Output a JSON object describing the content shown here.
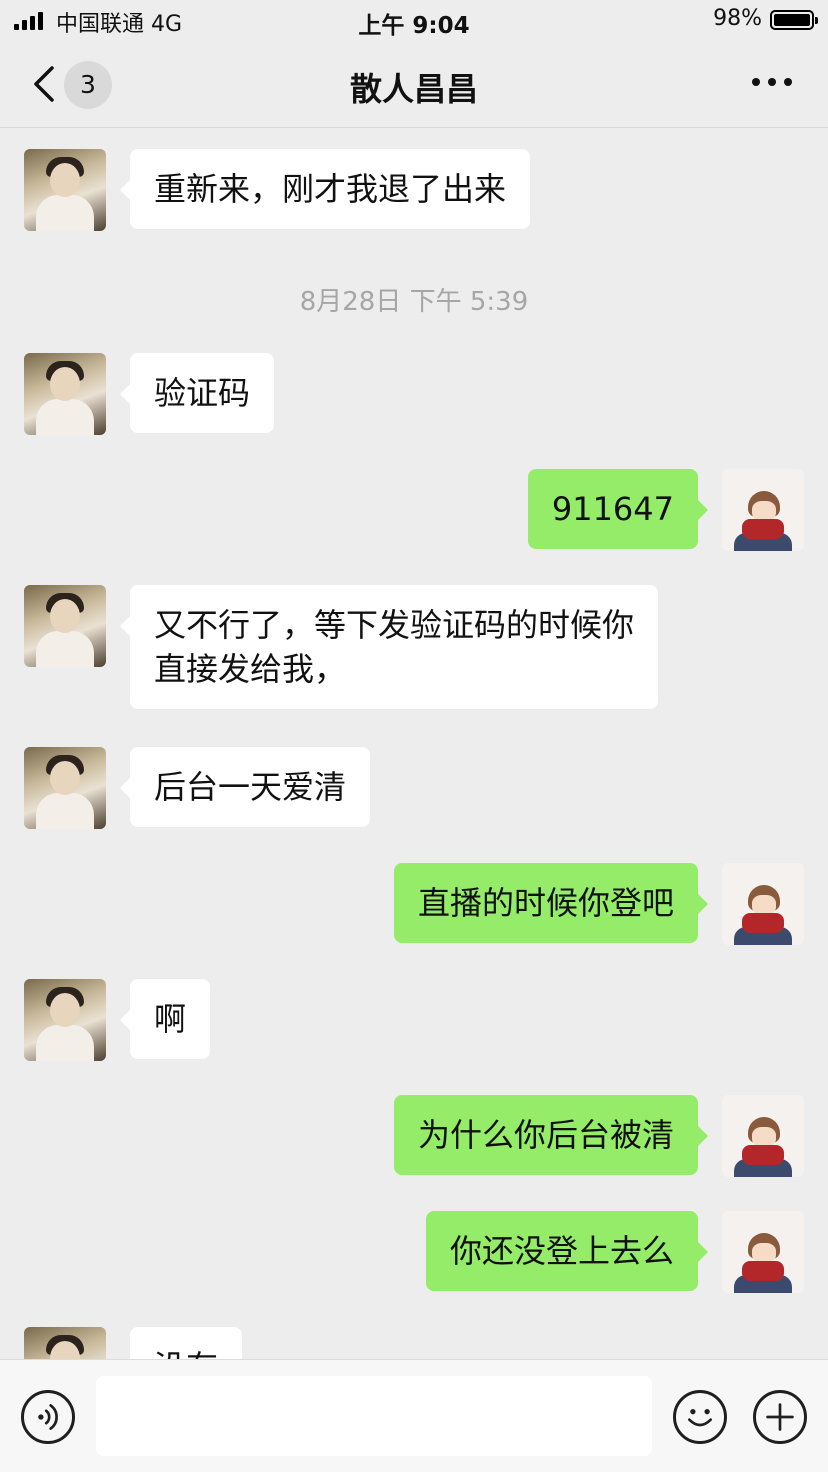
{
  "status_bar": {
    "carrier": "中国联通   4G",
    "time": "上午 9:04",
    "battery": "98%"
  },
  "nav": {
    "unread_count": "3",
    "title": "散人昌昌"
  },
  "messages": [
    {
      "sender": "friend",
      "text": "重新来，刚才我退了出来"
    },
    {
      "sender": "system",
      "text": "8月28日 下午 5:39"
    },
    {
      "sender": "friend",
      "text": "验证码"
    },
    {
      "sender": "self",
      "text": "911647"
    },
    {
      "sender": "friend",
      "text": "又不行了，等下发验证码的时候你\n直接发给我，"
    },
    {
      "sender": "friend",
      "text": "后台一天爱清"
    },
    {
      "sender": "self",
      "text": "直播的时候你登吧"
    },
    {
      "sender": "friend",
      "text": "啊"
    },
    {
      "sender": "self",
      "text": "为什么你后台被清"
    },
    {
      "sender": "self",
      "text": "你还没登上去么"
    },
    {
      "sender": "friend",
      "text": "没有"
    }
  ],
  "input_bar": {
    "placeholder": "",
    "icons": [
      "voice-icon",
      "emoji-icon",
      "plus-icon"
    ]
  },
  "colors": {
    "self_bubble": "#95ec69",
    "friend_bubble": "#ffffff",
    "background": "#ededed"
  }
}
